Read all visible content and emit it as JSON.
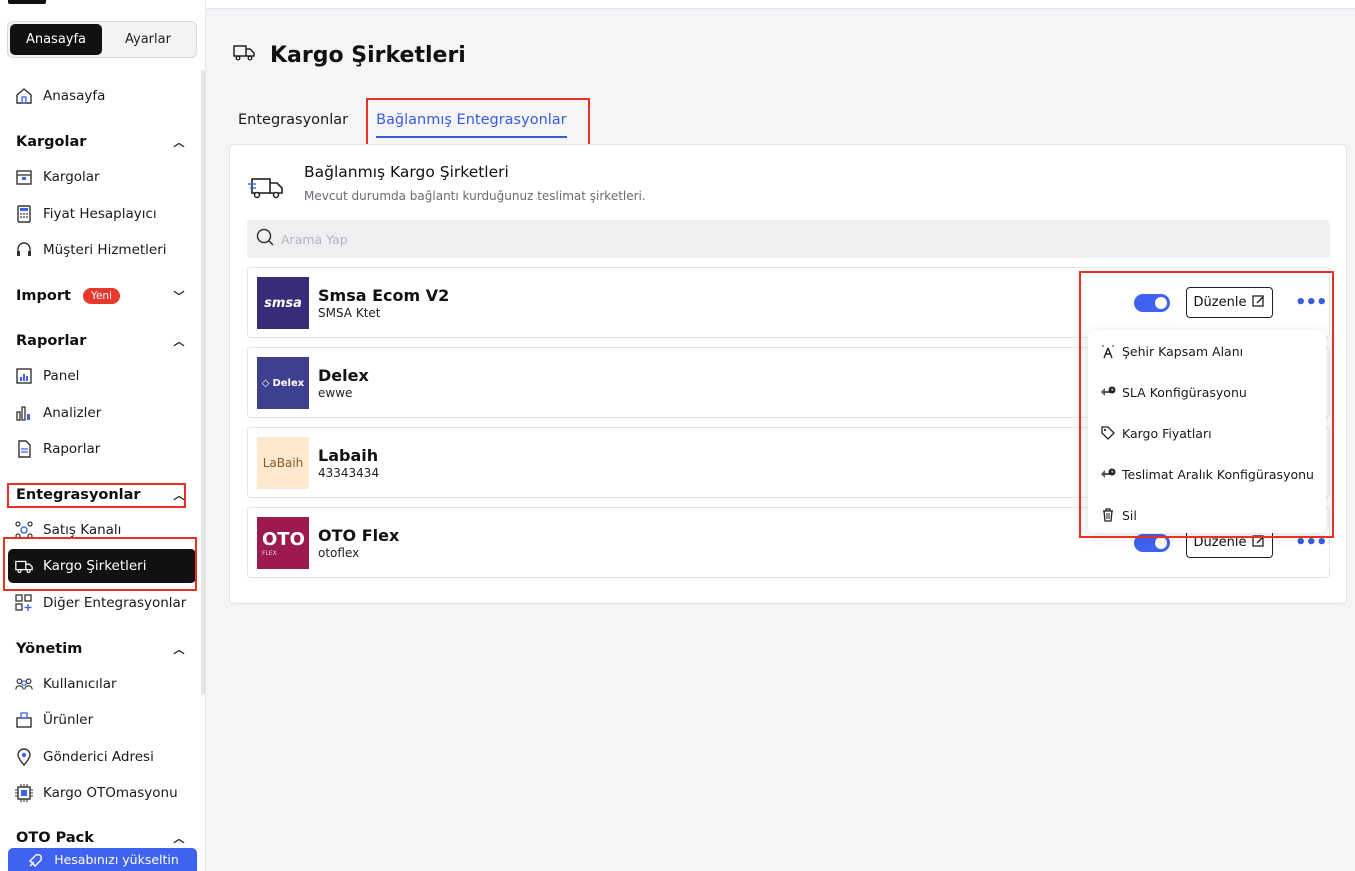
{
  "sidebar": {
    "segments": [
      "Anasayfa",
      "Ayarlar"
    ],
    "home": "Anasayfa",
    "sections": {
      "kargolar": {
        "title": "Kargolar",
        "items": [
          "Kargolar",
          "Fiyat Hesaplayıcı",
          "Müşteri Hizmetleri"
        ]
      },
      "import": {
        "title": "Import",
        "badge": "Yeni"
      },
      "raporlar": {
        "title": "Raporlar",
        "items": [
          "Panel",
          "Analizler",
          "Raporlar"
        ]
      },
      "entegrasyonlar": {
        "title": "Entegrasyonlar",
        "items": [
          "Satış Kanalı",
          "Kargo Şirketleri",
          "Diğer Entegrasyonlar"
        ]
      },
      "yonetim": {
        "title": "Yönetim",
        "items": [
          "Kullanıcılar",
          "Ürünler",
          "Gönderici Adresi",
          "Kargo OTOmasyonu"
        ]
      },
      "otopack": {
        "title": "OTO Pack"
      }
    },
    "upgrade_label": "Hesabınızı yükseltin"
  },
  "page": {
    "title": "Kargo Şirketleri",
    "tabs": [
      "Entegrasyonlar",
      "Bağlanmış Entegrasyonlar"
    ],
    "active_tab": "Bağlanmış Entegrasyonlar"
  },
  "panel": {
    "title": "Bağlanmış Kargo Şirketleri",
    "subtitle": "Mevcut durumda bağlantı kurduğunuz teslimat şirketleri.",
    "search_placeholder": "Arama Yap"
  },
  "carriers": [
    {
      "name": "Smsa Ecom V2",
      "account": "SMSA Ktet",
      "logo_text": "smsa",
      "logo_bg": "#3a2a7a",
      "enabled": true
    },
    {
      "name": "Delex",
      "account": "ewwe",
      "logo_text": "Delex",
      "logo_bg": "#3d3f8f",
      "enabled": true
    },
    {
      "name": "Labaih",
      "account": "43343434",
      "logo_text": "LaBaih",
      "logo_bg": "#fde8d0",
      "enabled": true
    },
    {
      "name": "OTO Flex",
      "account": "otoflex",
      "logo_text": "OTO",
      "logo_sub": "FLEX",
      "logo_bg": "#9c1a50",
      "enabled": true
    }
  ],
  "card_actions": {
    "edit_label": "Düzenle",
    "more_label": "•••"
  },
  "menu": {
    "items": [
      {
        "label": "Şehir Kapsam Alanı",
        "icon": "antenna-icon"
      },
      {
        "label": "SLA Konfigürasyonu",
        "icon": "sla-config-icon"
      },
      {
        "label": "Kargo Fiyatları",
        "icon": "tag-icon"
      },
      {
        "label": "Teslimat Aralık Konfigürasyonu",
        "icon": "delivery-range-icon"
      },
      {
        "label": "Sil",
        "icon": "trash-icon"
      }
    ]
  },
  "colors": {
    "accent": "#3f63f0",
    "highlight": "#e53222",
    "dark": "#111111"
  }
}
